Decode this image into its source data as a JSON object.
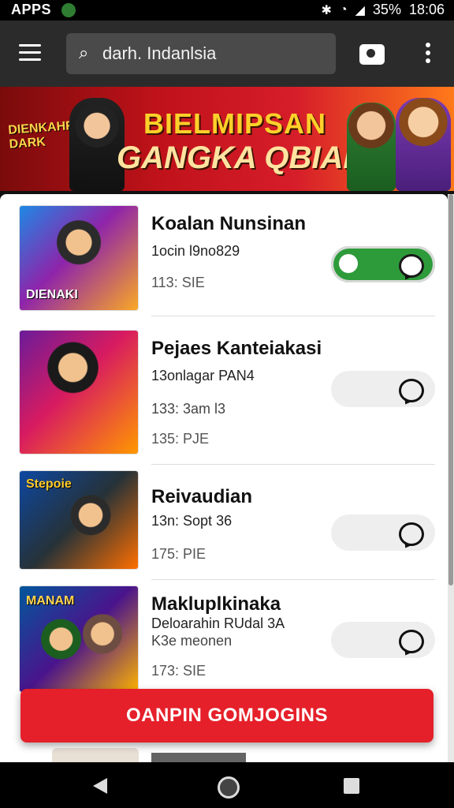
{
  "status": {
    "left_label": "APPS",
    "battery": "35%",
    "time": "18:06"
  },
  "search": {
    "value": "darh. Indanlsia"
  },
  "banner": {
    "logo": "DIENKAHR DARK",
    "title1": "BIELMIPSAN",
    "title2": "GANGKA QBIAM"
  },
  "items": [
    {
      "thumb_caption": "DIENAKI",
      "title": "Koalan Nunsinan",
      "line1": "1ocin l9no829",
      "line2": "",
      "line3": "113: SIE",
      "toggle_on": true
    },
    {
      "thumb_caption": "",
      "title": "Pejaes Kanteiakasi",
      "line1": "13onlagar PAN4",
      "line2": "133: 3am l3",
      "line3": "135: PJE",
      "toggle_on": false
    },
    {
      "thumb_caption": "Stepoie",
      "title": "Reivaudian",
      "line1": "13n: Sopt 36",
      "line2": "",
      "line3": "175: PIE",
      "toggle_on": false
    },
    {
      "thumb_caption": "MANAM",
      "title": "Makluplkinaka",
      "line1": "Deloarahin RUdal 3A",
      "line2": "K3e meonen",
      "line3": "173: SIE",
      "toggle_on": false
    }
  ],
  "cta": {
    "label": "OANPIN GOMJOGINS"
  },
  "colors": {
    "accent": "#e5202a",
    "toggle_on": "#2e9b3a",
    "topbar": "#2b2b2b"
  },
  "icons": [
    "menu-icon",
    "search-icon",
    "camera-icon",
    "more-vert-icon",
    "chat-icon",
    "back-icon",
    "home-icon",
    "recents-icon"
  ]
}
